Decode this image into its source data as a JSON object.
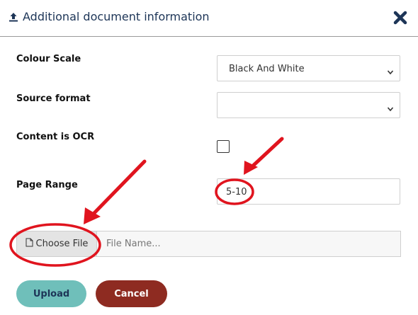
{
  "header": {
    "title": "Additional document information",
    "title_icon": "upload-icon",
    "close_icon": "close-icon"
  },
  "form": {
    "colour_scale": {
      "label": "Colour Scale",
      "value": "Black And White"
    },
    "source_format": {
      "label": "Source format",
      "value": ""
    },
    "content_ocr": {
      "label": "Content is OCR",
      "checked": false
    },
    "page_range": {
      "label": "Page Range",
      "value": "5-10"
    },
    "file": {
      "button_label": "Choose File",
      "placeholder": "File Name...",
      "icon": "file-icon"
    }
  },
  "buttons": {
    "upload": "Upload",
    "cancel": "Cancel"
  },
  "colors": {
    "title": "#1d3557",
    "upload_button": "#6fbfba",
    "cancel_button": "#8e2b21",
    "annotation": "#e0141e"
  }
}
